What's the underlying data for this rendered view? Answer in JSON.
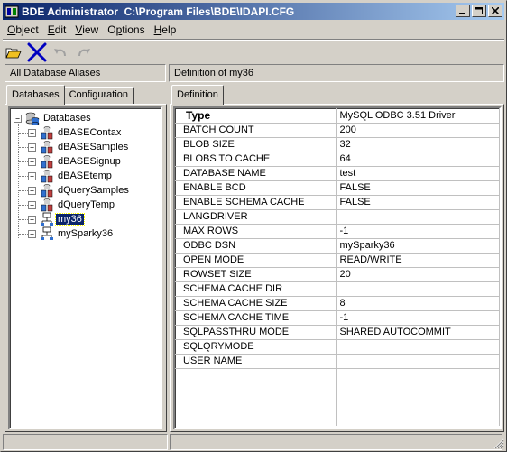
{
  "window": {
    "title": "BDE Administrator  C:\\Program Files\\BDE\\IDAPI.CFG"
  },
  "menu": [
    {
      "label": "Object",
      "accel": "O",
      "rest": "bject"
    },
    {
      "label": "Edit",
      "accel": "E",
      "rest": "dit"
    },
    {
      "label": "View",
      "accel": "V",
      "rest": "iew"
    },
    {
      "label": "Options",
      "accel": "p",
      "pre": "O",
      "rest": "tions"
    },
    {
      "label": "Help",
      "accel": "H",
      "rest": "elp"
    }
  ],
  "toolbar": {
    "icons": [
      "open-folder-icon",
      "delete-x-icon",
      "undo-icon",
      "redo-icon"
    ]
  },
  "left_header": "All Database Aliases",
  "right_header": "Definition of my36",
  "left_tabs": [
    "Databases",
    "Configuration"
  ],
  "right_tabs": [
    "Definition"
  ],
  "tree": {
    "root": "Databases",
    "items": [
      {
        "label": "dBASEContax",
        "type": "alias"
      },
      {
        "label": "dBASESamples",
        "type": "alias"
      },
      {
        "label": "dBASESignup",
        "type": "alias"
      },
      {
        "label": "dBASEtemp",
        "type": "alias"
      },
      {
        "label": "dQuerySamples",
        "type": "alias"
      },
      {
        "label": "dQueryTemp",
        "type": "alias"
      },
      {
        "label": "my36",
        "type": "odbc",
        "selected": true
      },
      {
        "label": "mySparky36",
        "type": "odbc"
      }
    ]
  },
  "definition": {
    "type_label": "Type",
    "type_value": "MySQL ODBC 3.51 Driver",
    "rows": [
      {
        "key": "BATCH COUNT",
        "value": "200"
      },
      {
        "key": "BLOB SIZE",
        "value": "32"
      },
      {
        "key": "BLOBS TO CACHE",
        "value": "64"
      },
      {
        "key": "DATABASE NAME",
        "value": "test"
      },
      {
        "key": "ENABLE BCD",
        "value": "FALSE"
      },
      {
        "key": "ENABLE SCHEMA CACHE",
        "value": "FALSE"
      },
      {
        "key": "LANGDRIVER",
        "value": ""
      },
      {
        "key": "MAX ROWS",
        "value": "-1"
      },
      {
        "key": "ODBC DSN",
        "value": "mySparky36"
      },
      {
        "key": "OPEN MODE",
        "value": "READ/WRITE"
      },
      {
        "key": "ROWSET SIZE",
        "value": "20"
      },
      {
        "key": "SCHEMA CACHE DIR",
        "value": ""
      },
      {
        "key": "SCHEMA CACHE SIZE",
        "value": "8"
      },
      {
        "key": "SCHEMA CACHE TIME",
        "value": "-1"
      },
      {
        "key": "SQLPASSTHRU MODE",
        "value": "SHARED AUTOCOMMIT"
      },
      {
        "key": "SQLQRYMODE",
        "value": ""
      },
      {
        "key": "USER NAME",
        "value": ""
      }
    ],
    "empty_rows": 4
  },
  "colors": {
    "title_start": "#0a246a",
    "title_end": "#a6caf0",
    "face": "#d4d0c8",
    "selection": "#0a246a"
  }
}
